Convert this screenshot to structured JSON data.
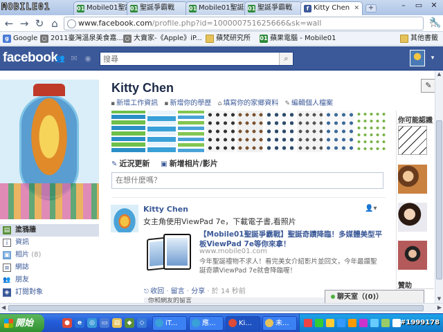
{
  "browser": {
    "watermark_logo": "MOBILE01",
    "tabs": [
      {
        "label": "Mobile01聖誕",
        "icon": "mobile01-icon"
      },
      {
        "label": "聖誕爭霸戰",
        "icon": "mobile01-icon"
      },
      {
        "label": "Mobile01聖誕",
        "icon": "mobile01-icon"
      },
      {
        "label": "聖誕爭霸戰",
        "icon": "mobile01-icon"
      },
      {
        "label": "Kitty Chen",
        "icon": "facebook-icon"
      }
    ],
    "new_tab_label": "+",
    "url_host": "www.facebook.com",
    "url_rest": "/profile.php?id=100000751625666&sk=wall",
    "bookmarks": [
      {
        "label": "Google",
        "icon": "google-icon"
      },
      {
        "label": "2011臺灣溫泉美食嘉...",
        "icon": "page-icon"
      },
      {
        "label": "大賣家-《Apple》iP...",
        "icon": "page-icon"
      },
      {
        "label": "蘋梵研究所",
        "icon": "folder-icon"
      },
      {
        "label": "蘋果電腦 - Mobile01",
        "icon": "mobile01-icon"
      }
    ],
    "other_bookmarks": "其他書籤"
  },
  "facebook": {
    "logo": "facebook",
    "search_placeholder": "搜尋",
    "profile_name": "Kitty Chen",
    "quick_links": [
      "新增工作資訊",
      "新增你的學歷",
      "填寫你的家鄉資料",
      "編輯個人檔案"
    ],
    "composer_tabs": [
      "近況更新",
      "新增相片/影片"
    ],
    "composer_placeholder": "在想什麼嗎？",
    "nav_items": [
      {
        "label": "塗鴉牆",
        "icon": "wall-icon",
        "active": true
      },
      {
        "label": "資訊",
        "icon": "info-icon"
      },
      {
        "label": "相片",
        "count": "(8)",
        "icon": "photo-icon"
      },
      {
        "label": "網誌",
        "icon": "notes-icon"
      },
      {
        "label": "朋友",
        "icon": "friends-icon"
      },
      {
        "label": "訂閱對象",
        "icon": "subscriptions-icon"
      }
    ],
    "story": {
      "author": "Kitty Chen",
      "text": "女主角使用ViewPad 7e，下載電子書,看照片",
      "attachment_title": "【Mobile01聖誕爭霸戰】聖誕奇蹟降臨！多媒體美型平板ViewPad 7e等你來拿！",
      "attachment_url": "www.mobile01.com",
      "attachment_desc": "今年聖誕禮物不求人！看完美女介紹影片並回文，今年最讚聖誕奇蹟ViewPad 7e就會降臨喔！",
      "actions": [
        "收回",
        "留言",
        "分享"
      ],
      "time": "於 14 秒前",
      "comments_hint": "你和網友的留言"
    },
    "right_column": {
      "suggestions_title": "你可能認識",
      "sponsored_title": "贊助"
    },
    "chat_label": "聊天室（(0)）"
  },
  "taskbar": {
    "start_label": "開始",
    "tasks": [
      {
        "label": "iT..."
      },
      {
        "label": "應..."
      },
      {
        "label": "Ki..."
      },
      {
        "label": "未..."
      }
    ],
    "watermark_id": "#1999178"
  }
}
